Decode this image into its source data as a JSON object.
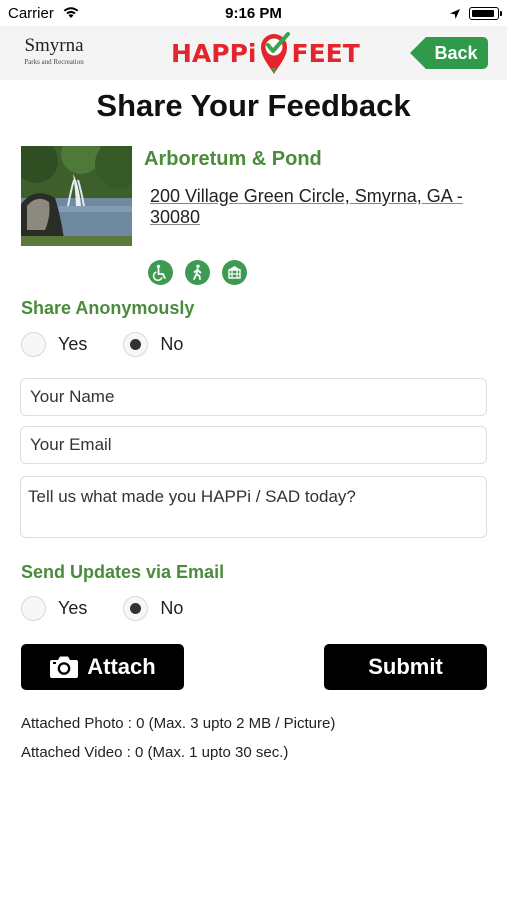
{
  "status_bar": {
    "carrier": "Carrier",
    "time": "9:16 PM"
  },
  "header": {
    "city_name": "Smyrna",
    "city_sub": "Parks and Recreation",
    "app_name_left": "HAPPi",
    "app_name_right": "FEET",
    "back_label": "Back"
  },
  "page_title": "Share Your Feedback",
  "park": {
    "name": "Arboretum & Pond",
    "address_line1": "200 Village Green Circle, Smyrna, GA -",
    "address_line2": "30080",
    "amenity_icons": [
      "wheelchair-accessible-icon",
      "walking-trail-icon",
      "pavilion-icon"
    ]
  },
  "anonymous": {
    "label": "Share Anonymously",
    "yes": "Yes",
    "no": "No",
    "selected": "No"
  },
  "form": {
    "name_placeholder": "Your Name",
    "email_placeholder": "Your Email",
    "message_placeholder": "Tell us what made you HAPPi / SAD today?"
  },
  "updates": {
    "label": "Send Updates via Email",
    "yes": "Yes",
    "no": "No",
    "selected": "No"
  },
  "buttons": {
    "attach": "Attach",
    "submit": "Submit"
  },
  "attachments": {
    "photo": "Attached Photo : 0 (Max. 3 upto 2 MB / Picture)",
    "video": "Attached Video : 0 (Max. 1 upto 30 sec.)"
  },
  "colors": {
    "accent_green": "#4a8c3c",
    "logo_red": "#e3262d",
    "back_green": "#2e9a4a"
  }
}
